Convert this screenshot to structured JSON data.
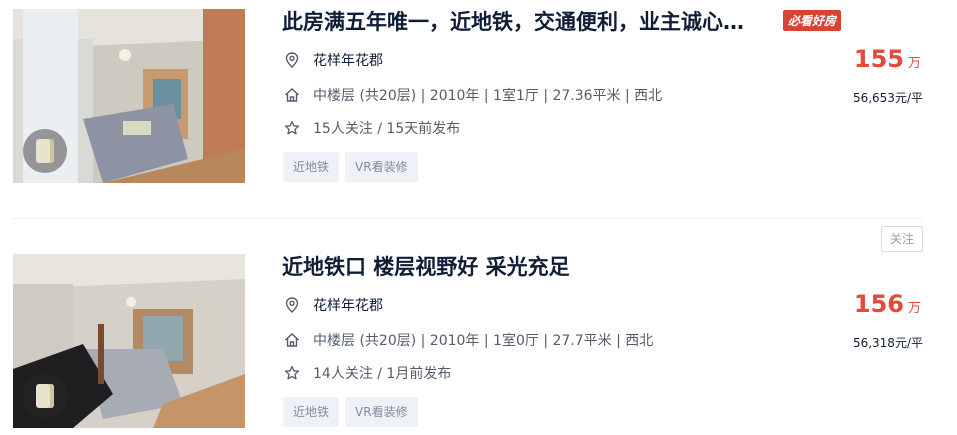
{
  "listings": [
    {
      "title": "此房满五年唯一，近地铁，交通便利，业主诚心…",
      "badge": "必看好房",
      "community": "花样年花郡",
      "house_info": "中楼层 (共20层) | 2010年 | 1室1厅 | 27.36平米 | 西北",
      "follow_info": "15人关注 / 15天前发布",
      "tags": [
        "近地铁",
        "VR看装修"
      ],
      "total_price": "155",
      "price_unit": "万",
      "unit_price": "56,653元/平"
    },
    {
      "title": "近地铁口 楼层视野好 采光充足",
      "follow_button": "关注",
      "community": "花样年花郡",
      "house_info": "中楼层 (共20层) | 2010年 | 1室0厅 | 27.7平米 | 西北",
      "follow_info": "14人关注 / 1月前发布",
      "tags": [
        "近地铁",
        "VR看装修"
      ],
      "total_price": "156",
      "price_unit": "万",
      "unit_price": "56,318元/平"
    }
  ],
  "colors": {
    "price": "#e04b3a",
    "badge_bg": "#d94335",
    "title": "#101d37",
    "tag_bg": "#eef2f6"
  },
  "icons": {
    "community": "location-pin-icon",
    "house_info": "house-icon",
    "follow_info": "star-icon",
    "vr": "vr-icon"
  }
}
